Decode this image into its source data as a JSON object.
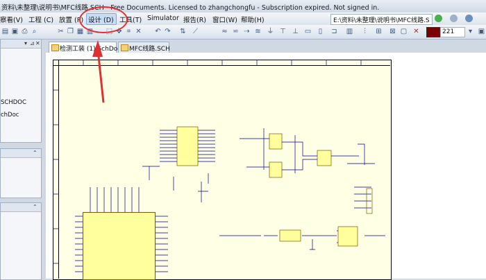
{
  "window": {
    "title": "资料\\未整理\\说明书\\MFC线路.SCH - Free Documents. Licensed to zhangchongfu - Subscription expired. Not signed in."
  },
  "menu": {
    "items": [
      {
        "label": "察看(V)"
      },
      {
        "label": "工程 (C)"
      },
      {
        "label": "放置 (P)"
      },
      {
        "label": "设计 (D)"
      },
      {
        "label": "工具(T)"
      },
      {
        "label": "Simulator"
      },
      {
        "label": "报告(R)"
      },
      {
        "label": "窗口(W)"
      },
      {
        "label": "帮助(H)"
      }
    ],
    "active_label": "设计 (D)"
  },
  "path_box": {
    "value": "E:\\资料\\未整理\\说明书\\MFC线路.S"
  },
  "toolbar": {
    "color_swatch": "#7a0000",
    "zoom_value": "221"
  },
  "left_panel": {
    "items": [
      {
        "label": "SCHDOC"
      },
      {
        "label": "chDoc"
      }
    ]
  },
  "document_tabs": [
    {
      "label": "检测工装 (1).SchDoc",
      "active": true
    },
    {
      "label": "MFC线路.SCH",
      "active": false
    }
  ],
  "annotation": {
    "highlight_color": "#e03030"
  }
}
